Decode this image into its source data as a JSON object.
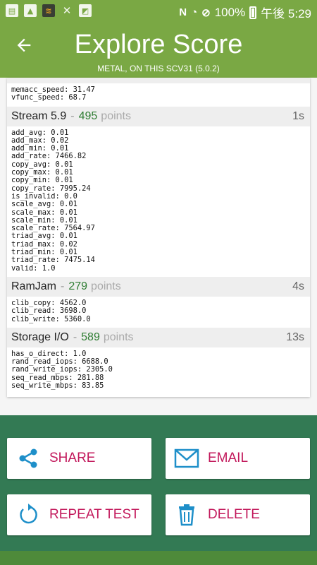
{
  "status_bar": {
    "battery": "100%",
    "time": "午後 5:29",
    "icons": [
      "sim-card-icon",
      "image-icon",
      "wheat-icon",
      "tools-icon",
      "explore-app-icon",
      "n-icon",
      "wifi-icon",
      "blocked-icon"
    ]
  },
  "header": {
    "back_icon": "arrow-left-icon",
    "title": "Explore Score",
    "subtitle": "METAL, ON THIS SCV31 (5.0.2)"
  },
  "top_values": [
    "memacc_speed: 31.47",
    "vfunc_speed: 68.7"
  ],
  "sections": [
    {
      "name": "Stream 5.9",
      "points": "495",
      "points_label": "points",
      "time": "1s",
      "values": [
        "add_avg: 0.01",
        "add_max: 0.02",
        "add_min: 0.01",
        "add_rate: 7466.82",
        "copy_avg: 0.01",
        "copy_max: 0.01",
        "copy_min: 0.01",
        "copy_rate: 7995.24",
        "is_invalid: 0.0",
        "scale_avg: 0.01",
        "scale_max: 0.01",
        "scale_min: 0.01",
        "scale_rate: 7564.97",
        "triad_avg: 0.01",
        "triad_max: 0.02",
        "triad_min: 0.01",
        "triad_rate: 7475.14",
        "valid: 1.0"
      ]
    },
    {
      "name": "RamJam",
      "points": "279",
      "points_label": "points",
      "time": "4s",
      "values": [
        "clib_copy: 4562.0",
        "clib_read: 3698.0",
        "clib_write: 5360.0"
      ]
    },
    {
      "name": "Storage I/O",
      "points": "589",
      "points_label": "points",
      "time": "13s",
      "values": [
        "has_o_direct: 1.0",
        "rand_read_iops: 6688.0",
        "rand_write_iops: 2305.0",
        "seq_read_mbps: 281.88",
        "seq_write_mbps: 83.85"
      ]
    }
  ],
  "actions": {
    "share": {
      "label": "SHARE",
      "icon": "share-icon"
    },
    "email": {
      "label": "EMAIL",
      "icon": "email-icon"
    },
    "repeat": {
      "label": "REPEAT TEST",
      "icon": "refresh-icon"
    },
    "delete": {
      "label": "DELETE",
      "icon": "trash-icon"
    }
  },
  "colors": {
    "appbar": "#7aa844",
    "bottom_panel": "#337a54",
    "points_green": "#2e7d32",
    "action_text": "#c2185b",
    "icon_blue": "#1e8fc9"
  }
}
